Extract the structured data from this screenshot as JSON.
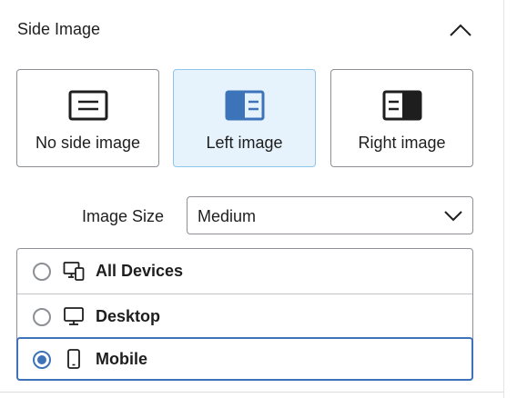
{
  "section": {
    "title": "Side Image",
    "collapse_icon": "chevron-up-icon"
  },
  "layout_options": [
    {
      "label": "No side image",
      "icon": "no-side-image-icon",
      "selected": false
    },
    {
      "label": "Left image",
      "icon": "left-image-icon",
      "selected": true
    },
    {
      "label": "Right image",
      "icon": "right-image-icon",
      "selected": false
    }
  ],
  "image_size": {
    "label": "Image Size",
    "value": "Medium",
    "icon": "chevron-down-icon"
  },
  "devices": [
    {
      "label": "All Devices",
      "icon": "all-devices-icon",
      "checked": false
    },
    {
      "label": "Desktop",
      "icon": "desktop-icon",
      "checked": false
    },
    {
      "label": "Mobile",
      "icon": "mobile-icon",
      "checked": true
    }
  ],
  "colors": {
    "accent": "#3d73b8",
    "selected_bg": "#e6f3fc",
    "selected_border": "#8ec5ea",
    "border": "#8c8f94",
    "text": "#1e1e1e"
  }
}
